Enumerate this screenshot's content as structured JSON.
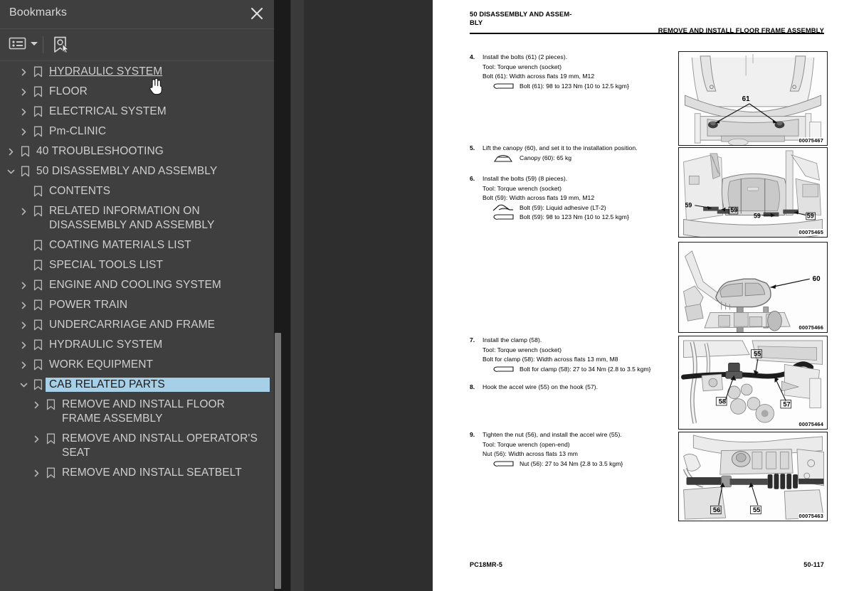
{
  "panel": {
    "title": "Bookmarks",
    "close_icon": "close-icon",
    "toolbar": {
      "options_icon": "list-options-icon",
      "caret_icon": "chevron-down-icon",
      "bookmark_cursor_icon": "bookmark-pointer-icon"
    }
  },
  "tree": {
    "items": [
      {
        "label": "HYDRAULIC SYSTEM",
        "level": 1,
        "twisty": "collapsed",
        "state": "hovered"
      },
      {
        "label": "FLOOR",
        "level": 1,
        "twisty": "collapsed",
        "state": "normal"
      },
      {
        "label": "ELECTRICAL SYSTEM",
        "level": 1,
        "twisty": "collapsed",
        "state": "normal"
      },
      {
        "label": "Pm-CLINIC",
        "level": 1,
        "twisty": "collapsed",
        "state": "normal"
      },
      {
        "label": "40 TROUBLESHOOTING",
        "level": 0,
        "twisty": "collapsed",
        "state": "normal"
      },
      {
        "label": "50 DISASSEMBLY AND ASSEMBLY",
        "level": 0,
        "twisty": "expanded",
        "state": "normal"
      },
      {
        "label": "CONTENTS",
        "level": 1,
        "twisty": "none",
        "state": "normal"
      },
      {
        "label": "RELATED INFORMATION ON DISASSEMBLY AND ASSEMBLY",
        "level": 1,
        "twisty": "collapsed",
        "state": "normal"
      },
      {
        "label": "COATING MATERIALS LIST",
        "level": 1,
        "twisty": "none",
        "state": "normal"
      },
      {
        "label": "SPECIAL TOOLS LIST",
        "level": 1,
        "twisty": "none",
        "state": "normal"
      },
      {
        "label": "ENGINE AND COOLING SYSTEM",
        "level": 1,
        "twisty": "collapsed",
        "state": "normal"
      },
      {
        "label": "POWER TRAIN",
        "level": 1,
        "twisty": "collapsed",
        "state": "normal"
      },
      {
        "label": "UNDERCARRIAGE AND FRAME",
        "level": 1,
        "twisty": "collapsed",
        "state": "normal"
      },
      {
        "label": "HYDRAULIC SYSTEM",
        "level": 1,
        "twisty": "collapsed",
        "state": "normal"
      },
      {
        "label": "WORK EQUIPMENT",
        "level": 1,
        "twisty": "collapsed",
        "state": "normal"
      },
      {
        "label": "CAB RELATED PARTS",
        "level": 1,
        "twisty": "expanded",
        "state": "selected"
      },
      {
        "label": "REMOVE AND INSTALL FLOOR FRAME ASSEMBLY",
        "level": 2,
        "twisty": "collapsed",
        "state": "normal"
      },
      {
        "label": "REMOVE AND INSTALL OPERATOR'S SEAT",
        "level": 2,
        "twisty": "collapsed",
        "state": "normal"
      },
      {
        "label": "REMOVE AND INSTALL SEATBELT",
        "level": 2,
        "twisty": "collapsed",
        "state": "normal"
      }
    ]
  },
  "collapse_handle": {
    "icon": "triangle-left-icon"
  },
  "document": {
    "header_left": "50 DISASSEMBLY AND ASSEM-­BLY",
    "header_left_line1": "50 DISASSEMBLY AND ASSEM-",
    "header_left_line2": "BLY",
    "header_right": "REMOVE AND INSTALL FLOOR FRAME ASSEMBLY",
    "footer_left": "PC18MR-5",
    "footer_right": "50-117",
    "steps": [
      {
        "num": "4.",
        "lines": [
          "Install the bolts (61) (2 pieces).",
          "Tool: Torque wrench (socket)",
          "Bolt (61): Width across flats 19 mm, M12"
        ],
        "specs": [
          {
            "symbol": "torque-wrench-icon",
            "text": "Bolt (61): 98 to 123 Nm {10 to 12.5 kgm}"
          }
        ]
      },
      {
        "num": "5.",
        "lines": [
          "Lift the canopy (60), and set it to the installation position."
        ],
        "specs": [
          {
            "symbol": "weight-sling-icon",
            "text": "Canopy (60): 65 kg"
          }
        ]
      },
      {
        "num": "6.",
        "lines": [
          "Install the bolts (59) (8 pieces).",
          "Tool: Torque wrench (socket)",
          "Bolt (59): Width across flats 19 mm, M12"
        ],
        "specs": [
          {
            "symbol": "adhesive-icon",
            "text": "Bolt (59): Liquid adhesive (LT-2)"
          },
          {
            "symbol": "torque-wrench-icon",
            "text": "Bolt (59): 98 to 123 Nm {10 to 12.5 kgm}"
          }
        ]
      },
      {
        "num": "7.",
        "lines": [
          "Install the clamp (58).",
          "Tool: Torque wrench (socket)",
          "Bolt for clamp (58): Width across flats 13 mm, M8"
        ],
        "specs": [
          {
            "symbol": "torque-wrench-icon",
            "text": "Bolt for clamp (58): 27 to 34 Nm {2.8 to 3.5 kgm}"
          }
        ]
      },
      {
        "num": "8.",
        "lines": [
          "Hook the accel wire (55) on the hook (57)."
        ],
        "specs": []
      },
      {
        "num": "9.",
        "lines": [
          "Tighten the nut (56), and install the accel wire (55).",
          "Tool: Torque wrench (open-end)",
          "Nut (56): Width across flats 13 mm"
        ],
        "specs": [
          {
            "symbol": "torque-wrench-icon",
            "text": "Nut (56): 27 to 34 Nm {2.8 to 3.5 kgm}"
          }
        ]
      }
    ],
    "figures": [
      {
        "caption": "00075467",
        "callouts": [
          "61"
        ]
      },
      {
        "caption": "00075465",
        "callouts": [
          "59",
          "59",
          "59",
          "59"
        ]
      },
      {
        "caption": "00075466",
        "callouts": [
          "60"
        ]
      },
      {
        "caption": "00075464",
        "callouts": [
          "55",
          "58",
          "57"
        ]
      },
      {
        "caption": "00075463",
        "callouts": [
          "56",
          "55"
        ]
      }
    ]
  },
  "colors": {
    "panel_bg": "#3f3f3f",
    "selection": "#a6cfe8",
    "page_bg": "#ffffff",
    "app_bg": "#232323"
  }
}
